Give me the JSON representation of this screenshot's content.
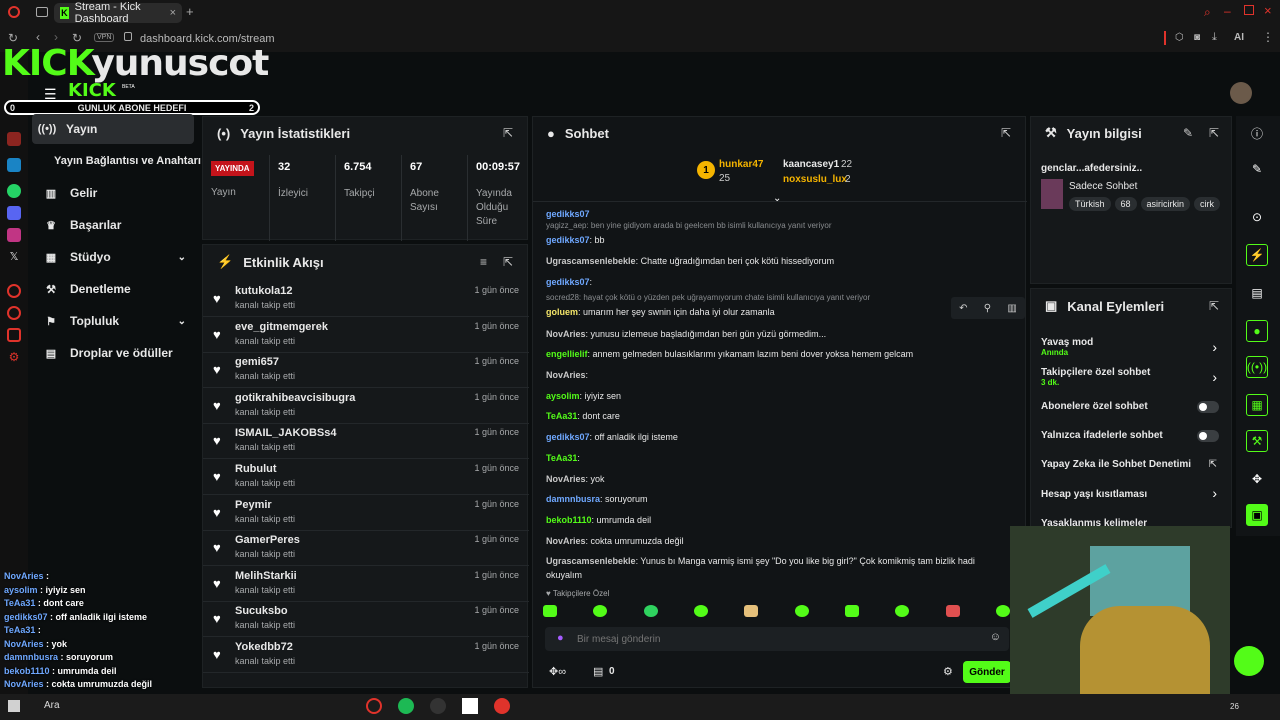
{
  "browser": {
    "tab_title": "Stream - Kick Dashboard",
    "vpn": "VPN",
    "url": "dashboard.kick.com/stream",
    "ai": "AI"
  },
  "overlay": {
    "logo_brand": "KICK",
    "logo_name": "yunuscot",
    "logo_small": "KICK",
    "beta": "BETA",
    "goal_left": "0",
    "goal_label": "GUNLUK ABONE HEDEFI",
    "goal_right": "2"
  },
  "sidebar": {
    "items": [
      {
        "label": "Yayın",
        "icon": "broadcast-icon"
      },
      {
        "label": "Yayın Bağlantısı ve Anahtarı",
        "icon": ""
      },
      {
        "label": "Gelir",
        "icon": "revenue-icon"
      },
      {
        "label": "Başarılar",
        "icon": "trophy-icon"
      },
      {
        "label": "Stüdyo",
        "icon": "studio-icon"
      },
      {
        "label": "Denetleme",
        "icon": "wrench-icon"
      },
      {
        "label": "Topluluk",
        "icon": "community-icon"
      },
      {
        "label": "Droplar ve ödüller",
        "icon": "drops-icon"
      }
    ]
  },
  "stats": {
    "title": "Yayın İstatistikleri",
    "live_badge": "YAYINDA",
    "cells": [
      {
        "value": "",
        "label": "Yayın"
      },
      {
        "value": "32",
        "label": "İzleyici"
      },
      {
        "value": "6.754",
        "label": "Takipçi"
      },
      {
        "value": "67",
        "label": "Abone Sayısı"
      },
      {
        "value": "00:09:57",
        "label": "Yayında Olduğu Süre"
      }
    ]
  },
  "activity": {
    "title": "Etkinlik Akışı",
    "items": [
      {
        "name": "kutukola12",
        "sub": "kanalı takip etti",
        "time": "1 gün önce"
      },
      {
        "name": "eve_gitmemgerek",
        "sub": "kanalı takip etti",
        "time": "1 gün önce"
      },
      {
        "name": "gemi657",
        "sub": "kanalı takip etti",
        "time": "1 gün önce"
      },
      {
        "name": "gotikrahibeavcisibugra",
        "sub": "kanalı takip etti",
        "time": "1 gün önce"
      },
      {
        "name": "ISMAIL_JAKOBSs4",
        "sub": "kanalı takip etti",
        "time": "1 gün önce"
      },
      {
        "name": "Rubulut",
        "sub": "kanalı takip etti",
        "time": "1 gün önce"
      },
      {
        "name": "Peymir",
        "sub": "kanalı takip etti",
        "time": "1 gün önce"
      },
      {
        "name": "GamerPeres",
        "sub": "kanalı takip etti",
        "time": "1 gün önce"
      },
      {
        "name": "MelihStarkii",
        "sub": "kanalı takip etti",
        "time": "1 gün önce"
      },
      {
        "name": "Sucuksbo",
        "sub": "kanalı takip etti",
        "time": "1 gün önce"
      },
      {
        "name": "Yokedbb72",
        "sub": "kanalı takip etti",
        "time": "1 gün önce"
      }
    ]
  },
  "chat": {
    "title": "Sohbet",
    "top": [
      {
        "rank": "1",
        "name": "hunkar47",
        "count": "25"
      },
      {
        "name": "kaancasey1",
        "count": "22"
      },
      {
        "name": "noxsuslu_lux",
        "count": "2"
      }
    ],
    "messages": [
      {
        "user": "gedikks07",
        "text": "",
        "color": "#6fa8ff"
      },
      {
        "reply": "yagizz_aep: ben yine gidiyom arada bi geelcem bb isimli kullanıcıya yanıt veriyor"
      },
      {
        "user": "gedikks07",
        "text": ": bb",
        "color": "#6fa8ff"
      },
      {
        "user": "Ugrascamsenlebekle",
        "text": ": Chatte uğradığımdan beri çok kötü hissediyorum",
        "color": "#c9c9c9"
      },
      {
        "user": "gedikks07",
        "text": ": ",
        "color": "#6fa8ff"
      },
      {
        "reply": "socred28: hayat çok kötü o yüzden pek uğrayamıyorum chate isimli kullanıcıya yanıt veriyor"
      },
      {
        "user": "goluem",
        "text": ": umarım her şey swnin için daha iyi olur zamanla",
        "color": "#f5e76a"
      },
      {
        "user": "NovAries",
        "text": ": yunusu izlemeue başladığımdan beri gün yüzü görmedim...",
        "color": "#c9c9c9"
      },
      {
        "user": "engellielif",
        "text": ": annem gelmeden bulasıklarımı yıkamam lazım beni dover yoksa hemem gelcam",
        "color": "#53fc18"
      },
      {
        "user": "NovAries",
        "text": ": ",
        "color": "#c9c9c9"
      },
      {
        "user": "aysolim",
        "text": ": iyiyiz sen",
        "color": "#53fc18"
      },
      {
        "user": "TeAa31",
        "text": ": dont care",
        "color": "#53fc18"
      },
      {
        "user": "gedikks07",
        "text": ": off anladik ilgi isteme",
        "color": "#6fa8ff"
      },
      {
        "user": "TeAa31",
        "text": ": ",
        "color": "#53fc18"
      },
      {
        "user": "NovAries",
        "text": ": yok",
        "color": "#c9c9c9"
      },
      {
        "user": "damnnbusra",
        "text": ": soruyorum",
        "color": "#6fa8ff"
      },
      {
        "user": "bekob1110",
        "text": ": umrumda deil",
        "color": "#53fc18"
      },
      {
        "user": "NovAries",
        "text": ": cokta umrumuzda değil",
        "color": "#c9c9c9"
      },
      {
        "user": "Ugrascamsenlebekle",
        "text": ": Yunus bı Manga varmiş ismi şey \"Do you like big girl?\" Çok komikmiş tam bizlik hadi okuyalım",
        "color": "#c9c9c9"
      }
    ],
    "followers_only": "Takipçilere Özel",
    "placeholder": "Bir mesaj gönderin",
    "points": "0",
    "send": "Gönder"
  },
  "info": {
    "title": "Yayın bilgisi",
    "stream_title": "genclar...afedersiniz..",
    "category": "Sadece Sohbet",
    "tags": [
      "Türkish",
      "68",
      "asiricirkin",
      "cirk"
    ]
  },
  "actions": {
    "title": "Kanal Eylemleri",
    "items": [
      {
        "label": "Yavaş mod",
        "sub": "Anında",
        "type": "chevron"
      },
      {
        "label": "Takipçilere özel sohbet",
        "sub": "3 dk.",
        "type": "chevron"
      },
      {
        "label": "Abonelere özel sohbet",
        "sub": "",
        "type": "toggle"
      },
      {
        "label": "Yalnızca ifadelerle sohbet",
        "sub": "",
        "type": "toggle"
      },
      {
        "label": "Yapay Zeka ile Sohbet Denetimi",
        "sub": "",
        "type": "external"
      },
      {
        "label": "Hesap yaşı kısıtlaması",
        "sub": "",
        "type": "chevron"
      },
      {
        "label": "Yasaklanmış kelimeler",
        "sub": "",
        "type": "chevron"
      }
    ]
  },
  "overlay_chat": [
    {
      "user": "NovAries",
      "text": " : "
    },
    {
      "user": "aysolim",
      "text": " : iyiyiz sen"
    },
    {
      "user": "TeAa31",
      "text": " : dont care"
    },
    {
      "user": "gedikks07",
      "text": " : off anladik ilgi isteme"
    },
    {
      "user": "TeAa31",
      "text": " : "
    },
    {
      "user": "NovAries",
      "text": " : yok"
    },
    {
      "user": "damnnbusra",
      "text": " : soruyorum"
    },
    {
      "user": "bekob1110",
      "text": " : umrumda deil"
    },
    {
      "user": "NovAries",
      "text": " : cokta umrumuzda değil"
    }
  ],
  "taskbar": {
    "search": "Ara",
    "clock": "26"
  }
}
